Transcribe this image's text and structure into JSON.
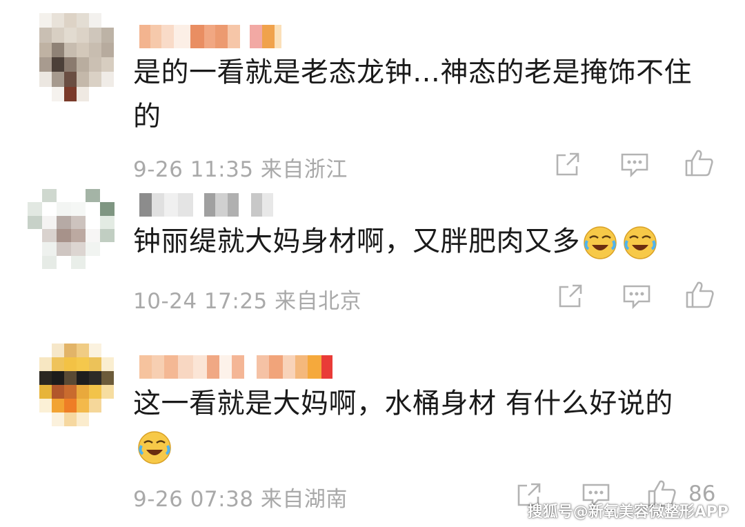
{
  "comments": [
    {
      "text": "是的一看就是老态龙钟…神态的老是掩饰不住的",
      "meta": "9-26 11:35 来自浙江",
      "like_count": ""
    },
    {
      "text": "钟丽缇就大妈身材啊，又胖肥肉又多",
      "meta": "10-24 17:25 来自北京",
      "like_count": ""
    },
    {
      "text": "这一看就是大妈啊，水桶身材 有什么好说的",
      "meta": "9-26 07:38 来自湖南",
      "like_count": "86"
    }
  ],
  "watermark": "搜狐号@新氧美容微整形APP",
  "icons": {
    "forward": "share-arrow-icon",
    "comment": "comment-bubble-icon",
    "like": "thumbs-up-icon",
    "emoji": "laughing-crying-emoji-icon"
  },
  "colors": {
    "text": "#1a1a1a",
    "meta": "#a9a9a9",
    "icon": "#b3b3b3",
    "emoji": "#f7c948"
  }
}
